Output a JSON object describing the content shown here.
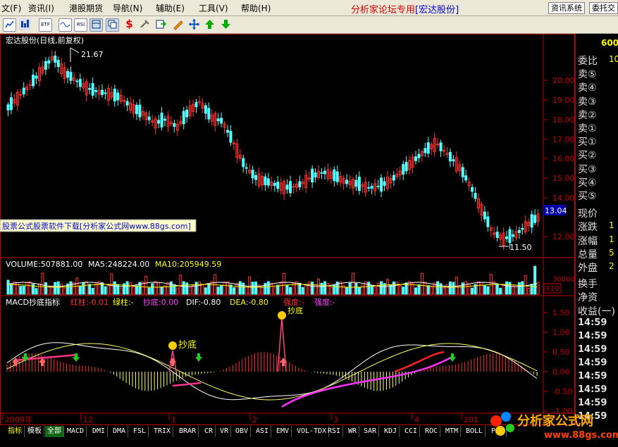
{
  "menu": {
    "items": [
      "文(F)",
      "资讯(I)",
      "港股期货",
      "导航(N)",
      "辅助(E)",
      "工具(V)",
      "帮助(H)"
    ],
    "title_prefix": "分析家论坛专用",
    "title_stock": "[宏达股份]",
    "btn_info": "资讯系统",
    "btn_entrust": "委托交"
  },
  "toolbar": {
    "icons": [
      "chart-icon",
      "vol-icon",
      "rsi-icon",
      "etf-icon",
      "wave-icon",
      "table-icon",
      "copy-icon",
      "dollar-icon",
      "tools-icon",
      "export-icon",
      "pen-icon",
      "move-icon",
      "up-arrow-icon",
      "down-arrow-icon"
    ],
    "labels": {
      "vol": "VOL",
      "rsi": "RSI",
      "etf": "ETF"
    }
  },
  "main_chart": {
    "title": "宏达股份(日线,前复权)",
    "high_label": "21.67",
    "low_label": "11.50",
    "current_price": "13.04",
    "y_ticks": [
      "20.00",
      "19.00",
      "18.00",
      "17.00",
      "16.00",
      "15.00",
      "14.00",
      "12.00"
    ],
    "watermark": "股票公式股票软件下载[分析家公式网www.88gs.com]"
  },
  "volume_chart": {
    "label": "VOLUME:507881.00",
    "ma5": "MA5:248224.00",
    "ma10": "MA10:205949.59",
    "y_tick": "30000",
    "unit": "X10"
  },
  "macd_chart": {
    "title": "MACD抄底指标",
    "red": "红柱:-0.01",
    "green": "绿柱:-",
    "bottom": "抄底:0.00",
    "dif": "DIF:-0.80",
    "dea": "DEA:-0.80",
    "strength1": "强度:-",
    "strength2": "强度:-",
    "annotation": "抄底",
    "annotation2": "抄底",
    "y_ticks": [
      "1.50",
      "1.00",
      "0.50",
      "0.00",
      "-0.50",
      "-1.00"
    ]
  },
  "x_axis": {
    "labels": [
      "2009年",
      "12",
      "1",
      "2",
      "3",
      "4",
      "201"
    ]
  },
  "right_panel": {
    "top_value": "600",
    "rows": [
      {
        "label": "委比",
        "value": "10"
      },
      {
        "label": "卖⑤",
        "value": ""
      },
      {
        "label": "卖④",
        "value": ""
      },
      {
        "label": "卖③",
        "value": ""
      },
      {
        "label": "卖②",
        "value": ""
      },
      {
        "label": "卖①",
        "value": ""
      },
      {
        "label": "买①",
        "value": ""
      },
      {
        "label": "买②",
        "value": ""
      },
      {
        "label": "买③",
        "value": ""
      },
      {
        "label": "买④",
        "value": ""
      },
      {
        "label": "买⑤",
        "value": ""
      },
      {
        "label": "现价",
        "value": ""
      },
      {
        "label": "涨跌",
        "value": "1"
      },
      {
        "label": "涨幅",
        "value": "1"
      },
      {
        "label": "总量",
        "value": "5"
      },
      {
        "label": "外盘",
        "value": "2"
      },
      {
        "label": "换手",
        "value": ""
      },
      {
        "label": "净资",
        "value": ""
      },
      {
        "label": "收益(一)",
        "value": ""
      }
    ],
    "times": [
      "14:59",
      "14:59",
      "14:59",
      "14:59",
      "14:59",
      "14:59",
      "14:59",
      "14:59"
    ]
  },
  "tabs": [
    "指标",
    "模板",
    "全部",
    "MACD",
    "DMI",
    "DMA",
    "FSL",
    "TRIX",
    "BRAR",
    "CR",
    "VR",
    "OBV",
    "ASI",
    "EMV",
    "VOL-TDX",
    "RSI",
    "WR",
    "SAR",
    "KDJ",
    "CCI",
    "ROC",
    "MTM",
    "BOLL",
    "PSY"
  ],
  "logo": {
    "text": "分析家公式网",
    "url": "www.88gs.com"
  },
  "colors": {
    "up": "#ff3232",
    "down": "#54ffff",
    "axis": "#c00000",
    "yellow": "#ffff00",
    "macd_dif": "#ffffff",
    "macd_dea": "#ffff00"
  }
}
